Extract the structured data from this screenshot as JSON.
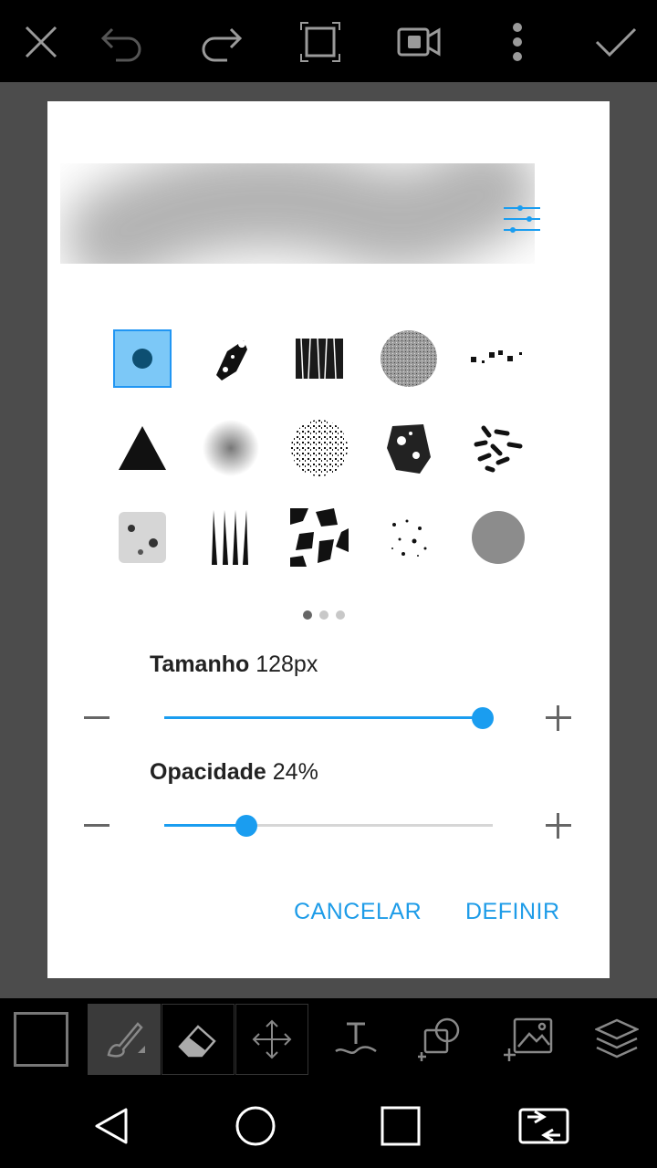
{
  "topbar": {
    "icons": [
      "close-icon",
      "undo-icon",
      "redo-icon",
      "crop-icon",
      "video-icon",
      "more-vert-icon",
      "check-icon"
    ]
  },
  "dialog": {
    "brush_pages": {
      "current": 1,
      "total": 3
    },
    "size": {
      "label": "Tamanho",
      "value_text": "128px",
      "fraction": 0.97
    },
    "opacity": {
      "label": "Opacidade",
      "value_text": "24%",
      "fraction": 0.25
    },
    "cancel_label": "CANCELAR",
    "confirm_label": "DEFINIR"
  },
  "toolbar": {
    "tools": [
      "color-swatch",
      "brush-tool-icon",
      "eraser-tool-icon",
      "move-tool-icon",
      "text-tool-icon",
      "shape-tool-icon",
      "add-image-icon",
      "layers-icon"
    ]
  },
  "colors": {
    "accent": "#1a9df0",
    "selected_bg": "#7cc8f7"
  }
}
